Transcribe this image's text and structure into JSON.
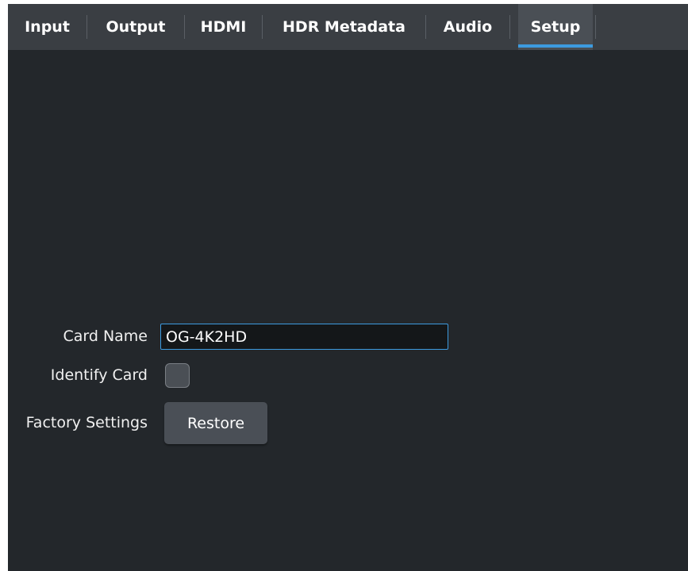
{
  "tabs": [
    {
      "label": "Input",
      "active": false
    },
    {
      "label": "Output",
      "active": false
    },
    {
      "label": "HDMI",
      "active": false
    },
    {
      "label": "HDR Metadata",
      "active": false
    },
    {
      "label": "Audio",
      "active": false
    },
    {
      "label": "Setup",
      "active": true
    }
  ],
  "setup": {
    "card_name_label": "Card Name",
    "card_name_value": "OG-4K2HD",
    "identify_card_label": "Identify Card",
    "identify_card_checked": false,
    "factory_settings_label": "Factory Settings",
    "restore_button_label": "Restore"
  },
  "colors": {
    "background": "#23272b",
    "tabbar": "#3a3e43",
    "active_tab": "#4a4f55",
    "accent": "#3d9be0"
  }
}
